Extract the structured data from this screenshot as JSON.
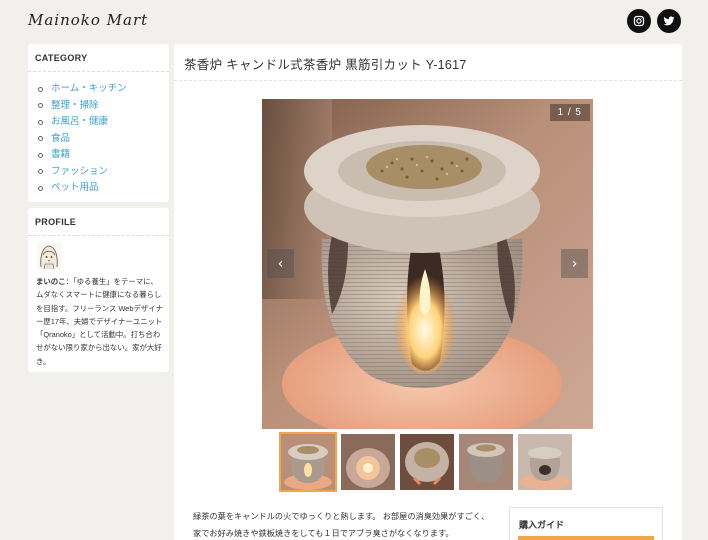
{
  "header": {
    "logo_text": "Mainoko Mart",
    "social": [
      {
        "icon": "instagram-icon"
      },
      {
        "icon": "twitter-icon"
      }
    ]
  },
  "sidebar": {
    "category": {
      "heading": "CATEGORY",
      "items": [
        {
          "label": "ホーム・キッチン"
        },
        {
          "label": "整理・掃除"
        },
        {
          "label": "お風呂・健康"
        },
        {
          "label": "食品"
        },
        {
          "label": "書籍"
        },
        {
          "label": "ファッション"
        },
        {
          "label": "ペット用品"
        }
      ]
    },
    "profile": {
      "heading": "PROFILE",
      "name": "まいのこ",
      "bio": "：「ゆる養生」をテーマに、ムダなくスマートに健康になる暮らしを目指す。フリーランス Webデザイナー歴17年、夫婦でデザイナーユニット「Qranoko」として活動中。打ち合わせがない限り家から出ない。家が大好き。"
    }
  },
  "product": {
    "title": "茶香炉 キャンドル式茶香炉 黒筋引カット Y-1617",
    "gallery": {
      "counter": "1 / 5",
      "prev_icon": "chevron-left-icon",
      "next_icon": "chevron-right-icon",
      "thumbnail_count": 5,
      "active_index": 0
    },
    "description": "緑茶の葉をキャンドルの火でゆっくりと熱します。 お部屋の消臭効果がすごく、家でお好み焼きや鉄板焼きをしても１日でアブラ臭さがなくなります。",
    "buy_guide": {
      "title": "購入ガイド"
    }
  },
  "colors": {
    "accent": "#f2a64c",
    "link": "#3aa2cf",
    "background": "#f2f0ec"
  }
}
